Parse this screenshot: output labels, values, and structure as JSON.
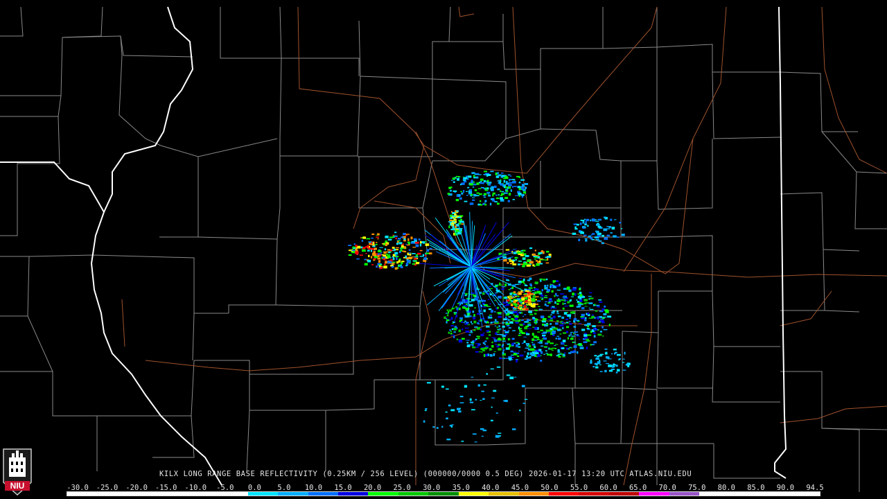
{
  "product": {
    "caption": "KILX LONG RANGE BASE REFLECTIVITY (0.25KM / 256 LEVEL) (000000/0000 0.5 DEG) 2026-01-17 13:20 UTC  ATLAS.NIU.EDU"
  },
  "logo": {
    "text": "NIU",
    "icon": "niu-tower-icon"
  },
  "colorbar": {
    "tick_labels": [
      "-30.0",
      "-25.0",
      "-20.0",
      "-15.0",
      "-10.0",
      "-5.0",
      "0.0",
      "5.0",
      "10.0",
      "15.0",
      "20.0",
      "25.0",
      "30.0",
      "35.0",
      "40.0",
      "45.0",
      "50.0",
      "55.0",
      "60.0",
      "65.0",
      "70.0",
      "75.0",
      "80.0",
      "85.0",
      "90.0",
      "94.5"
    ],
    "colors": [
      "#ffffff",
      "#ffffff",
      "#ffffff",
      "#ffffff",
      "#ffffff",
      "#ffffff",
      "#00e5ff",
      "#00b0ff",
      "#0070ff",
      "#0000e0",
      "#00ff00",
      "#00c800",
      "#009000",
      "#ffff00",
      "#e7c000",
      "#ff9000",
      "#ff0000",
      "#d60000",
      "#c00000",
      "#ff00ff",
      "#9955c9",
      "#ffffff",
      "#ffffff",
      "#ffffff",
      "#ffffff"
    ]
  },
  "colors": {
    "background": "#000000",
    "county_borders": "#8a8a8a",
    "state_borders": "#ffffff",
    "highways": "#a0522d"
  }
}
